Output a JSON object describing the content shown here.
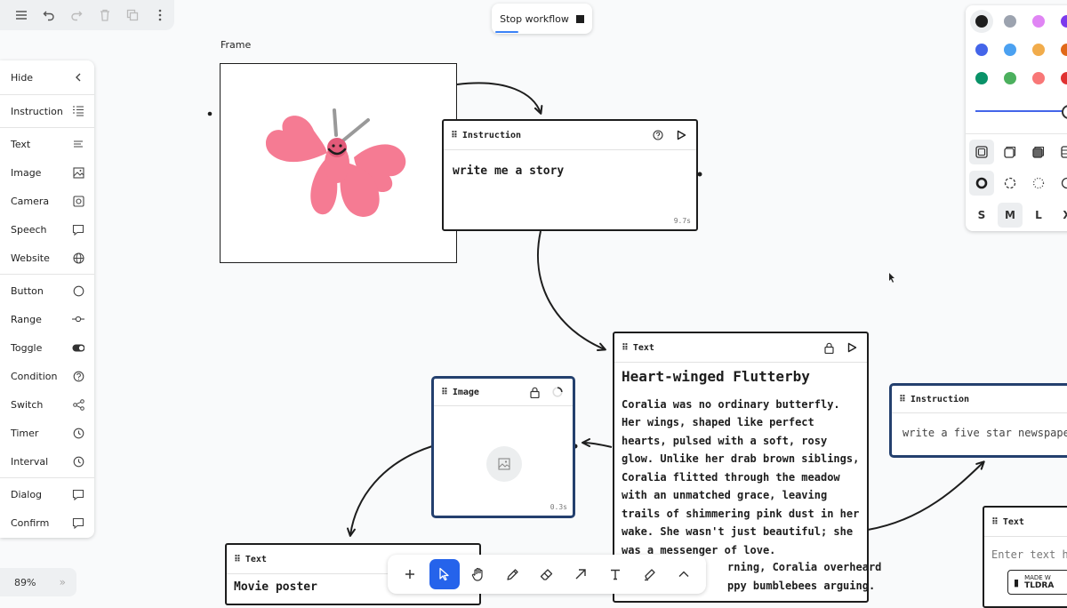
{
  "topbar": {
    "icons": [
      "menu-icon",
      "undo-icon",
      "redo-icon",
      "trash-icon",
      "duplicate-icon",
      "more-icon"
    ]
  },
  "palette": {
    "items": [
      {
        "label": "Hide",
        "icon": "chevron-left-icon"
      },
      {
        "label": "Instruction",
        "icon": "instruction-icon"
      },
      {
        "label": "Text",
        "icon": "text-lines-icon"
      },
      {
        "label": "Image",
        "icon": "image-icon"
      },
      {
        "label": "Camera",
        "icon": "camera-icon"
      },
      {
        "label": "Speech",
        "icon": "speech-bubble-icon"
      },
      {
        "label": "Website",
        "icon": "globe-icon"
      },
      {
        "label": "Button",
        "icon": "circle-icon"
      },
      {
        "label": "Range",
        "icon": "range-icon"
      },
      {
        "label": "Toggle",
        "icon": "toggle-icon"
      },
      {
        "label": "Condition",
        "icon": "question-icon"
      },
      {
        "label": "Switch",
        "icon": "share-icon"
      },
      {
        "label": "Timer",
        "icon": "clock-icon"
      },
      {
        "label": "Interval",
        "icon": "clock-icon"
      },
      {
        "label": "Dialog",
        "icon": "message-icon"
      },
      {
        "label": "Confirm",
        "icon": "message-icon"
      }
    ]
  },
  "zoom": {
    "value": "89%"
  },
  "workflow": {
    "stop_label": "Stop workflow"
  },
  "frame": {
    "label": "Frame"
  },
  "nodes": {
    "instruction1": {
      "title": "Instruction",
      "body": "write me a story",
      "timing": "9.7s"
    },
    "text1": {
      "title": "Text",
      "heading": "Heart-winged Flutterby",
      "body": "Coralia was no ordinary butterfly. Her wings, shaped like perfect hearts, pulsed with a soft, rosy glow. Unlike her drab brown siblings, Coralia flitted through the meadow with an unmatched grace, leaving trails of shimmering pink dust in her wake. She wasn't just beautiful; she was a messenger of love.",
      "tail1": "rning, Coralia overheard",
      "tail2": "ppy bumblebees arguing."
    },
    "image1": {
      "title": "Image",
      "timing": "0.3s"
    },
    "text2": {
      "title": "Text",
      "body": "Movie poster"
    },
    "instruction2": {
      "title": "Instruction",
      "body": "write a five star newspaper"
    },
    "text3": {
      "title": "Text",
      "placeholder": "Enter text he"
    }
  },
  "bottombar": {
    "tools": [
      "plus-icon",
      "select-icon",
      "hand-icon",
      "pencil-icon",
      "eraser-icon",
      "arrow-icon",
      "text-icon",
      "highlighter-icon",
      "chevron-up-icon"
    ],
    "active": "select-icon"
  },
  "stylepanel": {
    "colors": [
      "#1d1d1d",
      "#9ca3af",
      "#e085f4",
      "#7c3aed",
      "#4465e9",
      "#4ba1f1",
      "#f1ac4b",
      "#e16919",
      "#099268",
      "#4cb05e",
      "#f87777",
      "#e03131"
    ],
    "sizes": [
      "S",
      "M",
      "L",
      "X"
    ],
    "selected_size": "M"
  },
  "badge": {
    "line1": "MADE W",
    "line2": "TLDRA"
  }
}
